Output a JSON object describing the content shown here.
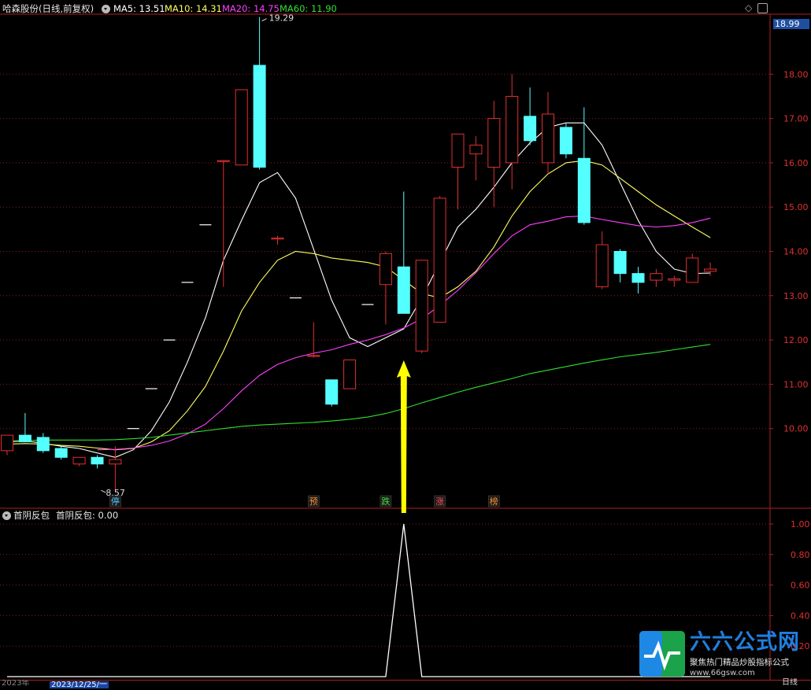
{
  "main_header": {
    "stock": "哈森股份(日线,前复权)",
    "ma5": "MA5: 13.51",
    "ma10": "MA10: 14.31",
    "ma20": "MA20: 14.75",
    "ma60": "MA60: 11.90"
  },
  "indicator_header": {
    "name": "首阴反包",
    "value": "首阴反包: 0.00"
  },
  "colors": {
    "up": "#e03030",
    "down": "#54ffff",
    "ma5": "#ffffff",
    "ma10": "#ffff60",
    "ma20": "#ff40ff",
    "ma60": "#30e030",
    "grid": "#8b1a1a",
    "arrow": "#ffff00"
  },
  "price_box": "18.99",
  "high_label": "19.29",
  "low_label": "8.57",
  "signal_tags": [
    {
      "i": 6,
      "text": "停",
      "color": "#54c8ff"
    },
    {
      "i": 17,
      "text": "预",
      "color": "#ff9030"
    },
    {
      "i": 21,
      "text": "跌",
      "color": "#40e040"
    },
    {
      "i": 24,
      "text": "涨",
      "color": "#ff5050"
    },
    {
      "i": 27,
      "text": "榜",
      "color": "#ff9030"
    }
  ],
  "footer": {
    "year": "2023年",
    "selected_date": "2023/12/25/一",
    "period": "日线"
  },
  "logo": {
    "title": "六六公式网",
    "subtitle": "聚焦热门精品炒股指标公式",
    "url": "www.66gsw.com"
  },
  "chart_data": [
    {
      "type": "candlestick",
      "title": "哈森股份(日线,前复权)",
      "ylim": [
        9.25,
        19.2
      ],
      "yticks": [
        10.0,
        11.0,
        12.0,
        13.0,
        14.0,
        15.0,
        16.0,
        17.0,
        18.0
      ],
      "y_tick_labels": [
        "10.00",
        "11.00",
        "12.00",
        "13.00",
        "14.00",
        "15.00",
        "16.00",
        "17.00",
        "18.00"
      ],
      "candles": [
        {
          "o": 9.5,
          "h": 9.85,
          "l": 9.4,
          "c": 9.85
        },
        {
          "o": 9.85,
          "h": 10.35,
          "l": 9.75,
          "c": 9.7
        },
        {
          "o": 9.8,
          "h": 9.9,
          "l": 9.45,
          "c": 9.5
        },
        {
          "o": 9.55,
          "h": 9.6,
          "l": 9.3,
          "c": 9.35
        },
        {
          "o": 9.2,
          "h": 9.35,
          "l": 9.15,
          "c": 9.35
        },
        {
          "o": 9.35,
          "h": 9.4,
          "l": 9.1,
          "c": 9.2
        },
        {
          "o": 9.2,
          "h": 9.6,
          "l": 8.57,
          "c": 9.3
        },
        {
          "o": 10.0,
          "h": 10.0,
          "l": 10.0,
          "c": 10.0
        },
        {
          "o": 10.9,
          "h": 10.9,
          "l": 10.9,
          "c": 10.9
        },
        {
          "o": 12.0,
          "h": 12.0,
          "l": 12.0,
          "c": 12.0
        },
        {
          "o": 13.3,
          "h": 13.3,
          "l": 13.3,
          "c": 13.3
        },
        {
          "o": 14.6,
          "h": 14.6,
          "l": 14.6,
          "c": 14.6
        },
        {
          "o": 16.05,
          "h": 16.05,
          "l": 13.2,
          "c": 16.05
        },
        {
          "o": 15.95,
          "h": 17.65,
          "l": 15.95,
          "c": 17.65
        },
        {
          "o": 18.2,
          "h": 19.29,
          "l": 15.85,
          "c": 15.9
        },
        {
          "o": 14.3,
          "h": 14.35,
          "l": 14.15,
          "c": 14.3
        },
        {
          "o": 12.95,
          "h": 12.95,
          "l": 12.95,
          "c": 12.95
        },
        {
          "o": 11.65,
          "h": 12.4,
          "l": 11.6,
          "c": 11.65
        },
        {
          "o": 11.1,
          "h": 11.1,
          "l": 10.5,
          "c": 10.55
        },
        {
          "o": 10.9,
          "h": 11.55,
          "l": 10.9,
          "c": 11.55
        },
        {
          "o": 12.8,
          "h": 12.8,
          "l": 12.8,
          "c": 12.8
        },
        {
          "o": 13.25,
          "h": 14.0,
          "l": 12.35,
          "c": 13.95
        },
        {
          "o": 13.65,
          "h": 15.35,
          "l": 12.6,
          "c": 12.6
        },
        {
          "o": 11.75,
          "h": 13.8,
          "l": 11.7,
          "c": 13.8
        },
        {
          "o": 12.4,
          "h": 15.25,
          "l": 12.4,
          "c": 15.2
        },
        {
          "o": 15.9,
          "h": 16.65,
          "l": 14.95,
          "c": 16.65
        },
        {
          "o": 16.2,
          "h": 16.6,
          "l": 15.6,
          "c": 16.4
        },
        {
          "o": 15.9,
          "h": 17.4,
          "l": 15.0,
          "c": 17.0
        },
        {
          "o": 16.0,
          "h": 18.0,
          "l": 15.4,
          "c": 17.5
        },
        {
          "o": 17.05,
          "h": 17.7,
          "l": 16.4,
          "c": 16.5
        },
        {
          "o": 16.0,
          "h": 17.6,
          "l": 15.75,
          "c": 17.1
        },
        {
          "o": 16.8,
          "h": 16.9,
          "l": 16.1,
          "c": 16.2
        },
        {
          "o": 16.1,
          "h": 17.25,
          "l": 14.6,
          "c": 14.65
        },
        {
          "o": 13.2,
          "h": 14.45,
          "l": 13.15,
          "c": 14.15
        },
        {
          "o": 14.0,
          "h": 14.05,
          "l": 13.3,
          "c": 13.5
        },
        {
          "o": 13.5,
          "h": 13.65,
          "l": 13.05,
          "c": 13.3
        },
        {
          "o": 13.35,
          "h": 13.6,
          "l": 13.2,
          "c": 13.5
        },
        {
          "o": 13.35,
          "h": 13.45,
          "l": 13.2,
          "c": 13.38
        },
        {
          "o": 13.3,
          "h": 13.95,
          "l": 13.3,
          "c": 13.85
        },
        {
          "o": 13.55,
          "h": 13.75,
          "l": 13.45,
          "c": 13.6
        }
      ],
      "series": [
        {
          "name": "MA5",
          "values": [
            9.7,
            9.72,
            9.67,
            9.6,
            9.55,
            9.45,
            9.35,
            9.52,
            9.95,
            10.6,
            11.5,
            12.5,
            13.8,
            14.7,
            15.55,
            15.78,
            15.2,
            14.05,
            12.9,
            12.05,
            11.85,
            12.05,
            12.25,
            12.95,
            13.75,
            14.55,
            14.95,
            15.45,
            16.0,
            16.45,
            16.8,
            16.9,
            16.9,
            16.4,
            15.55,
            14.7,
            14.0,
            13.6,
            13.5,
            13.51
          ]
        },
        {
          "name": "MA10",
          "values": [
            9.65,
            9.66,
            9.65,
            9.62,
            9.6,
            9.56,
            9.52,
            9.55,
            9.7,
            9.95,
            10.4,
            10.95,
            11.75,
            12.65,
            13.3,
            13.8,
            14.0,
            13.95,
            13.85,
            13.8,
            13.75,
            13.65,
            13.35,
            13.05,
            12.95,
            13.2,
            13.55,
            14.1,
            14.8,
            15.35,
            15.75,
            16.0,
            16.05,
            15.95,
            15.65,
            15.35,
            15.05,
            14.8,
            14.55,
            14.31
          ]
        },
        {
          "name": "MA20",
          "values": [
            null,
            null,
            null,
            null,
            null,
            9.52,
            9.53,
            9.56,
            9.62,
            9.72,
            9.88,
            10.1,
            10.45,
            10.85,
            11.2,
            11.45,
            11.6,
            11.7,
            11.78,
            11.9,
            12.0,
            12.12,
            12.27,
            12.48,
            12.78,
            13.12,
            13.52,
            13.95,
            14.35,
            14.6,
            14.68,
            14.78,
            14.8,
            14.72,
            14.65,
            14.58,
            14.55,
            14.58,
            14.65,
            14.75
          ]
        },
        {
          "name": "MA60",
          "values": [
            9.72,
            9.73,
            9.74,
            9.74,
            9.74,
            9.74,
            9.75,
            9.77,
            9.8,
            9.85,
            9.9,
            9.95,
            10.0,
            10.05,
            10.08,
            10.1,
            10.12,
            10.14,
            10.17,
            10.21,
            10.26,
            10.34,
            10.45,
            10.58,
            10.7,
            10.82,
            10.93,
            11.03,
            11.13,
            11.24,
            11.32,
            11.4,
            11.48,
            11.55,
            11.62,
            11.67,
            11.72,
            11.78,
            11.84,
            11.9
          ]
        }
      ]
    },
    {
      "type": "line",
      "title": "首阴反包",
      "ylim": [
        0,
        1.0
      ],
      "yticks": [
        0.2,
        0.4,
        0.6,
        0.8,
        1.0
      ],
      "y_tick_labels": [
        "0.20",
        "0.40",
        "0.60",
        "0.80",
        "1.00"
      ],
      "series": [
        {
          "name": "首阴反包",
          "values": [
            0,
            0,
            0,
            0,
            0,
            0,
            0,
            0,
            0,
            0,
            0,
            0,
            0,
            0,
            0,
            0,
            0,
            0,
            0,
            0,
            0,
            0,
            1,
            0,
            0,
            0,
            0,
            0,
            0,
            0,
            0,
            0,
            0,
            0,
            0,
            0,
            0,
            0,
            0,
            0
          ]
        }
      ]
    }
  ]
}
